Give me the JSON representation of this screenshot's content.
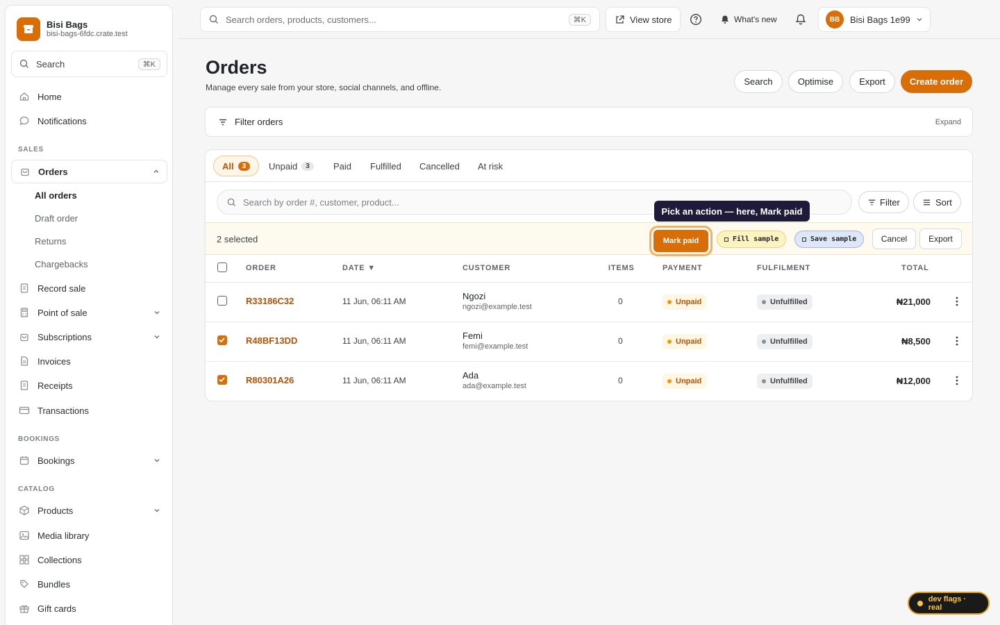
{
  "brand": {
    "name": "Bisi Bags",
    "host": "bisi-bags-6fdc.crate.test"
  },
  "sidebar": {
    "search_label": "Search",
    "search_kbd": "⌘K",
    "home": "Home",
    "notifications": "Notifications",
    "sec_sales": "SALES",
    "orders": "Orders",
    "subs": [
      "All orders",
      "Draft order",
      "Returns",
      "Chargebacks"
    ],
    "record_sale": "Record sale",
    "pos": "Point of sale",
    "subscriptions": "Subscriptions",
    "invoices": "Invoices",
    "receipts": "Receipts",
    "transactions": "Transactions",
    "sec_bookings": "BOOKINGS",
    "bookings": "Bookings",
    "sec_catalog": "CATALOG",
    "products": "Products",
    "media": "Media library",
    "collections": "Collections",
    "bundles": "Bundles",
    "giftcards": "Gift cards"
  },
  "topbar": {
    "search_placeholder": "Search orders, products, customers...",
    "search_kbd": "⌘K",
    "view_store": "View store",
    "whats_new": "What's new",
    "user_initials": "BB",
    "user_name": "Bisi Bags 1e99"
  },
  "page": {
    "title": "Orders",
    "subtitle": "Manage every sale from your store, social channels, and offline.",
    "btn_search": "Search",
    "btn_optimise": "Optimise",
    "btn_export": "Export",
    "btn_create": "Create order",
    "filter_label": "Filter orders",
    "filter_expand": "Expand"
  },
  "tabs": [
    {
      "label": "All",
      "count": "3"
    },
    {
      "label": "Unpaid",
      "count": "3"
    },
    {
      "label": "Paid"
    },
    {
      "label": "Fulfilled"
    },
    {
      "label": "Cancelled"
    },
    {
      "label": "At risk"
    }
  ],
  "orders_search_placeholder": "Search by order #, customer, product...",
  "filter_btn": "Filter",
  "sort_btn": "Sort",
  "selection": {
    "count_text": "2 selected",
    "mark_paid": "Mark paid",
    "fill_sample": "Fill sample",
    "save_sample": "Save sample",
    "cancel": "Cancel",
    "export": "Export"
  },
  "tooltip": "Pick an action — here, Mark paid",
  "table": {
    "headers": {
      "order": "ORDER",
      "date": "DATE",
      "customer": "CUSTOMER",
      "items": "ITEMS",
      "payment": "PAYMENT",
      "fulfilment": "FULFILMENT",
      "total": "TOTAL"
    },
    "sort_indicator": "▼",
    "rows": [
      {
        "id": "R33186C32",
        "date": "11 Jun, 06:11 AM",
        "name": "Ngozi",
        "email": "ngozi@example.test",
        "items": "0",
        "payment": "Unpaid",
        "fulfilment": "Unfulfilled",
        "total": "₦21,000",
        "checked": false
      },
      {
        "id": "R48BF13DD",
        "date": "11 Jun, 06:11 AM",
        "name": "Femi",
        "email": "femi@example.test",
        "items": "0",
        "payment": "Unpaid",
        "fulfilment": "Unfulfilled",
        "total": "₦8,500",
        "checked": true
      },
      {
        "id": "R80301A26",
        "date": "11 Jun, 06:11 AM",
        "name": "Ada",
        "email": "ada@example.test",
        "items": "0",
        "payment": "Unpaid",
        "fulfilment": "Unfulfilled",
        "total": "₦12,000",
        "checked": true
      }
    ]
  },
  "devflags": "dev flags · real",
  "colors": {
    "accent": "#d96e08",
    "tooltip_bg": "#1e1b3a"
  }
}
